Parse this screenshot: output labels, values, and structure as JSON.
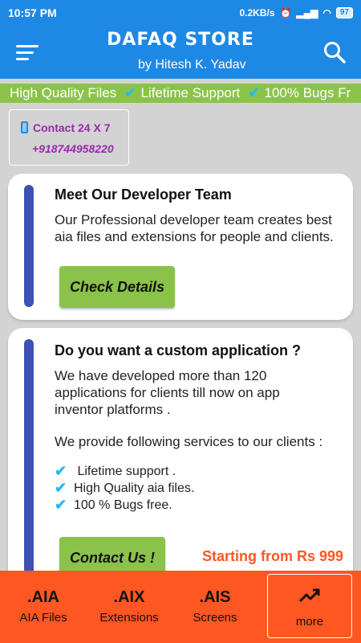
{
  "status": {
    "time": "10:57 PM",
    "net_speed": "0.2KB/s",
    "battery": "97"
  },
  "header": {
    "title": "DAFAQ STORE",
    "subtitle": "by Hitesh K. Yadav"
  },
  "ticker": {
    "items": [
      "High Quality Files",
      "Lifetime Support",
      "100% Bugs Fr"
    ]
  },
  "contact": {
    "label": "Contact 24 X 7",
    "phone": "+918744958220"
  },
  "card1": {
    "title": "Meet Our Developer Team",
    "text_line1": "Our Professional developer team creates best",
    "text_line2": "aia files and extensions for people and clients.",
    "button": "Check Details"
  },
  "card2": {
    "title": "Do you want a custom application ?",
    "text_line1": "We have developed more than 120",
    "text_line2": "applications for clients till now on app",
    "text_line3": "inventor platforms .",
    "text_line4": "We provide following services to our clients :",
    "features": [
      "Lifetime support .",
      "High Quality aia files.",
      "100 % Bugs free."
    ],
    "button": "Contact Us !",
    "price": "Starting from Rs 999"
  },
  "nav": {
    "aia_ext": ".AIA",
    "aia_label": "AIA Files",
    "aix_ext": ".AIX",
    "aix_label": "Extensions",
    "ais_ext": ".AIS",
    "ais_label": "Screens",
    "more_label": "more"
  },
  "colors": {
    "app_bar": "#1e88e5",
    "ticker": "#8bc34a",
    "accent_bar": "#3f51b5",
    "button_green": "#8bc34a",
    "bottom_nav": "#ff5722",
    "contact_text": "#9c27b0",
    "price_text": "#ff5722"
  }
}
